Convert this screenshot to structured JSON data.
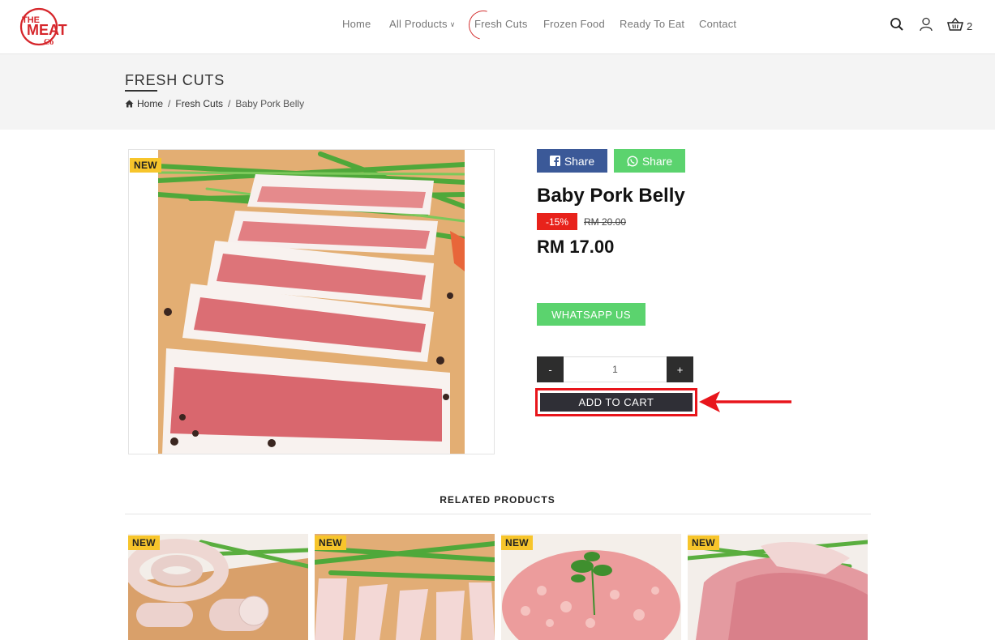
{
  "header": {
    "logo": {
      "line1": "THE",
      "line2": "MEAT",
      "line3": "Co"
    },
    "nav": [
      {
        "label": "Home"
      },
      {
        "label": "All Products"
      },
      {
        "label": "Fresh Cuts"
      },
      {
        "label": "Frozen Food"
      },
      {
        "label": "Ready To Eat"
      },
      {
        "label": "Contact"
      }
    ],
    "cart_count": "2",
    "icons": [
      "search-icon",
      "user-icon",
      "basket-icon"
    ]
  },
  "page": {
    "title": "FRESH CUTS",
    "breadcrumb": {
      "home": "Home",
      "category": "Fresh Cuts",
      "current": "Baby Pork Belly"
    }
  },
  "product": {
    "badge": "NEW",
    "share_facebook": "Share",
    "share_whatsapp": "Share",
    "name": "Baby Pork Belly",
    "discount": "-15%",
    "old_price": "RM 20.00",
    "price": "RM 17.00",
    "whatsapp_label": "WHATSAPP US",
    "qty_minus": "-",
    "qty_plus": "+",
    "quantity": "1",
    "add_to_cart": "ADD TO CART"
  },
  "related": {
    "title": "RELATED PRODUCTS",
    "items": [
      {
        "badge": "NEW"
      },
      {
        "badge": "NEW"
      },
      {
        "badge": "NEW"
      },
      {
        "badge": "NEW"
      }
    ]
  },
  "colors": {
    "accent_red": "#e8151b",
    "facebook": "#3b5998",
    "whatsapp": "#5bd36e",
    "dark_button": "#2f2f36",
    "badge_yellow": "#f7c52b"
  }
}
